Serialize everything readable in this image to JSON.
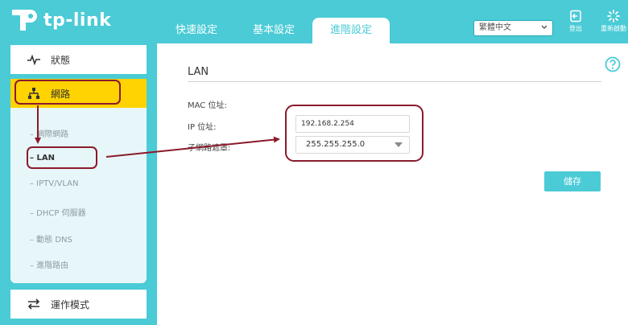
{
  "header": {
    "brand": "tp-link",
    "tabs": [
      {
        "label": "快速設定"
      },
      {
        "label": "基本設定"
      },
      {
        "label": "進階設定"
      }
    ],
    "language": "繁體中文",
    "logout_label": "登出",
    "reboot_label": "重新啟動"
  },
  "sidebar": {
    "status_label": "狀態",
    "network_label": "網路",
    "sub_items": [
      {
        "label": "– 網際網路"
      },
      {
        "label": "– LAN"
      },
      {
        "label": "– IPTV/VLAN"
      },
      {
        "label": "– DHCP 伺服器"
      },
      {
        "label": "– 動態 DNS"
      },
      {
        "label": "– 進階路由"
      }
    ],
    "mode_label": "運作模式"
  },
  "main": {
    "title": "LAN",
    "mac_label": "MAC 位址:",
    "ip_label": "IP 位址:",
    "ip_value": "192.168.2.254",
    "subnet_label": "子網路遮罩:",
    "subnet_value": "255.255.255.0",
    "save_label": "儲存"
  },
  "colors": {
    "brand": "#4acbd6",
    "active_menu": "#ffd300",
    "annotation": "#8b1a2b"
  }
}
